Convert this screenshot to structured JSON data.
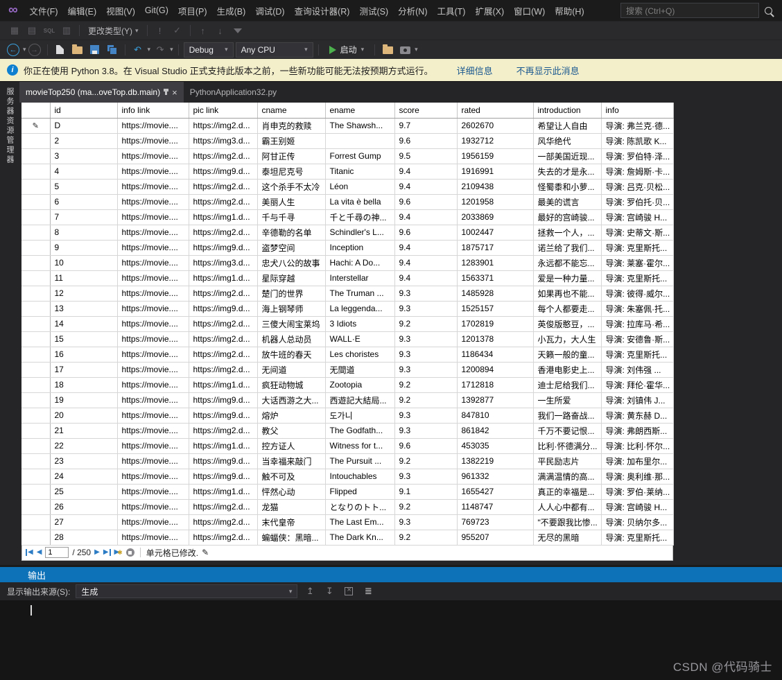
{
  "menu": {
    "items": [
      "文件(F)",
      "编辑(E)",
      "视图(V)",
      "Git(G)",
      "项目(P)",
      "生成(B)",
      "调试(D)",
      "查询设计器(R)",
      "测试(S)",
      "分析(N)",
      "工具(T)",
      "扩展(X)",
      "窗口(W)",
      "帮助(H)"
    ],
    "search_placeholder": "搜索 (Ctrl+Q)"
  },
  "toolbar_query": {
    "change_type_label": "更改类型(Y)",
    "sql_pane_label": "SQL"
  },
  "toolbar_debug": {
    "debug_combo": "Debug",
    "cpu_combo": "Any CPU",
    "start_label": "启动"
  },
  "infobar": {
    "message": "你正在使用 Python 3.8。在 Visual Studio 正式支持此版本之前，一些新功能可能无法按预期方式运行。",
    "details_link": "详细信息",
    "dismiss_link": "不再显示此消息"
  },
  "tabs": [
    {
      "label": "movieTop250 (ma...oveTop.db.main)",
      "active": true
    },
    {
      "label": "PythonApplication32.py",
      "active": false
    }
  ],
  "sidebar": {
    "vertical_label": "服务器资源管理器"
  },
  "grid": {
    "columns": [
      "id",
      "info link",
      "pic link",
      "cname",
      "ename",
      "score",
      "rated",
      "introduction",
      "info"
    ],
    "edit_row_index": 0,
    "rows": [
      [
        "D",
        "https://movie....",
        "https://img2.d...",
        "肖申克的救赎",
        "The Shawsh...",
        "9.7",
        "2602670",
        "希望让人自由",
        "导演: 弗兰克·德..."
      ],
      [
        "2",
        "https://movie....",
        "https://img3.d...",
        "霸王别姬",
        "",
        "9.6",
        "1932712",
        "风华绝代",
        "导演: 陈凯歌 K..."
      ],
      [
        "3",
        "https://movie....",
        "https://img2.d...",
        "阿甘正传",
        "Forrest Gump",
        "9.5",
        "1956159",
        "一部美国近现...",
        "导演: 罗伯特·泽..."
      ],
      [
        "4",
        "https://movie....",
        "https://img9.d...",
        "泰坦尼克号",
        "Titanic",
        "9.4",
        "1916991",
        "失去的才是永...",
        "导演: 詹姆斯·卡..."
      ],
      [
        "5",
        "https://movie....",
        "https://img2.d...",
        "这个杀手不太冷",
        "Léon",
        "9.4",
        "2109438",
        "怪蜀黍和小萝...",
        "导演: 吕克·贝松..."
      ],
      [
        "6",
        "https://movie....",
        "https://img2.d...",
        "美丽人生",
        "La vita è bella",
        "9.6",
        "1201958",
        "最美的谎言",
        "导演: 罗伯托·贝..."
      ],
      [
        "7",
        "https://movie....",
        "https://img1.d...",
        "千与千寻",
        "千と千尋の神...",
        "9.4",
        "2033869",
        "最好的宫崎骏...",
        "导演: 宫崎骏 H..."
      ],
      [
        "8",
        "https://movie....",
        "https://img2.d...",
        "辛德勒的名单",
        "Schindler's L...",
        "9.6",
        "1002447",
        "拯救一个人，...",
        "导演: 史蒂文·斯..."
      ],
      [
        "9",
        "https://movie....",
        "https://img9.d...",
        "盗梦空间",
        "Inception",
        "9.4",
        "1875717",
        "诺兰给了我们...",
        "导演: 克里斯托..."
      ],
      [
        "10",
        "https://movie....",
        "https://img3.d...",
        "忠犬八公的故事",
        "Hachi: A Do...",
        "9.4",
        "1283901",
        "永远都不能忘...",
        "导演: 莱塞·霍尔..."
      ],
      [
        "11",
        "https://movie....",
        "https://img1.d...",
        "星际穿越",
        "Interstellar",
        "9.4",
        "1563371",
        "爱是一种力量...",
        "导演: 克里斯托..."
      ],
      [
        "12",
        "https://movie....",
        "https://img2.d...",
        "楚门的世界",
        "The Truman ...",
        "9.3",
        "1485928",
        "如果再也不能...",
        "导演: 彼得·威尔..."
      ],
      [
        "13",
        "https://movie....",
        "https://img9.d...",
        "海上钢琴师",
        "La leggenda...",
        "9.3",
        "1525157",
        "每个人都要走...",
        "导演: 朱塞佩·托..."
      ],
      [
        "14",
        "https://movie....",
        "https://img2.d...",
        "三傻大闹宝莱坞",
        "3 Idiots",
        "9.2",
        "1702819",
        "英俊版憨豆，...",
        "导演: 拉库马·希..."
      ],
      [
        "15",
        "https://movie....",
        "https://img2.d...",
        "机器人总动员",
        "WALL·E",
        "9.3",
        "1201378",
        "小瓦力，大人生",
        "导演: 安德鲁·斯..."
      ],
      [
        "16",
        "https://movie....",
        "https://img2.d...",
        "放牛班的春天",
        "Les choristes",
        "9.3",
        "1186434",
        "天籁一般的童...",
        "导演: 克里斯托..."
      ],
      [
        "17",
        "https://movie....",
        "https://img2.d...",
        "无间道",
        "无間道",
        "9.3",
        "1200894",
        "香港电影史上...",
        "导演: 刘伟强 ..."
      ],
      [
        "18",
        "https://movie....",
        "https://img1.d...",
        "疯狂动物城",
        "Zootopia",
        "9.2",
        "1712818",
        "迪士尼给我们...",
        "导演: 拜伦·霍华..."
      ],
      [
        "19",
        "https://movie....",
        "https://img9.d...",
        "大话西游之大...",
        "西遊記大結局...",
        "9.2",
        "1392877",
        "一生所爱",
        "导演: 刘镇伟 J..."
      ],
      [
        "20",
        "https://movie....",
        "https://img9.d...",
        "熔炉",
        "도가니",
        "9.3",
        "847810",
        "我们一路奋战...",
        "导演: 黄东赫 D..."
      ],
      [
        "21",
        "https://movie....",
        "https://img2.d...",
        "教父",
        "The Godfath...",
        "9.3",
        "861842",
        "千万不要记恨...",
        "导演: 弗朗西斯..."
      ],
      [
        "22",
        "https://movie....",
        "https://img1.d...",
        "控方证人",
        "Witness for t...",
        "9.6",
        "453035",
        "比利·怀德满分...",
        "导演: 比利·怀尔..."
      ],
      [
        "23",
        "https://movie....",
        "https://img9.d...",
        "当幸福来敲门",
        "The Pursuit ...",
        "9.2",
        "1382219",
        "平民励志片",
        "导演: 加布里尔..."
      ],
      [
        "24",
        "https://movie....",
        "https://img9.d...",
        "触不可及",
        "Intouchables",
        "9.3",
        "961332",
        "满满温情的高...",
        "导演: 奥利维·那..."
      ],
      [
        "25",
        "https://movie....",
        "https://img1.d...",
        "怦然心动",
        "Flipped",
        "9.1",
        "1655427",
        "真正的幸福是...",
        "导演: 罗伯·莱纳..."
      ],
      [
        "26",
        "https://movie....",
        "https://img2.d...",
        "龙猫",
        "となりのトト...",
        "9.2",
        "1148747",
        "人人心中都有...",
        "导演: 宫崎骏 H..."
      ],
      [
        "27",
        "https://movie....",
        "https://img2.d...",
        "末代皇帝",
        "The Last Em...",
        "9.3",
        "769723",
        "\"不要跟我比惨...",
        "导演: 贝纳尔多..."
      ],
      [
        "28",
        "https://movie....",
        "https://img2.d...",
        "蝙蝠侠：黑暗...",
        "The Dark Kn...",
        "9.2",
        "955207",
        "无尽的黑暗",
        "导演: 克里斯托..."
      ]
    ]
  },
  "navigator": {
    "current": "1",
    "total_label": "/ 250",
    "status": "单元格已修改."
  },
  "output": {
    "title": "输出",
    "source_label": "显示输出来源(S):",
    "source_value": "生成"
  },
  "watermark": "CSDN @代码骑士",
  "icons": {
    "vs_logo": "∞",
    "pane_diagram": "▦",
    "pane_criteria": "▤",
    "pane_results": "▥",
    "caret": "▾",
    "execute_sql": "!",
    "verify_sql": "✓",
    "sort_asc": "↑",
    "sort_desc": "↓",
    "back": "←",
    "forward": "→",
    "undo": "↶",
    "redo": "↷",
    "nav_first": "◀",
    "nav_prev": "◀",
    "nav_next": "▶",
    "nav_last": "▶",
    "new_row_arrow": "▶",
    "new_row_star": "✱",
    "pencil": "✎",
    "close": "×",
    "info": "i",
    "msg_prev": "↥",
    "msg_next": "↧",
    "word_wrap": "≣"
  },
  "colors": {
    "accent_blue": "#0d72b8",
    "infobar_bg": "#f4efcb",
    "grid_bg": "#ffffff",
    "title_bg": "#1b1b1c"
  }
}
